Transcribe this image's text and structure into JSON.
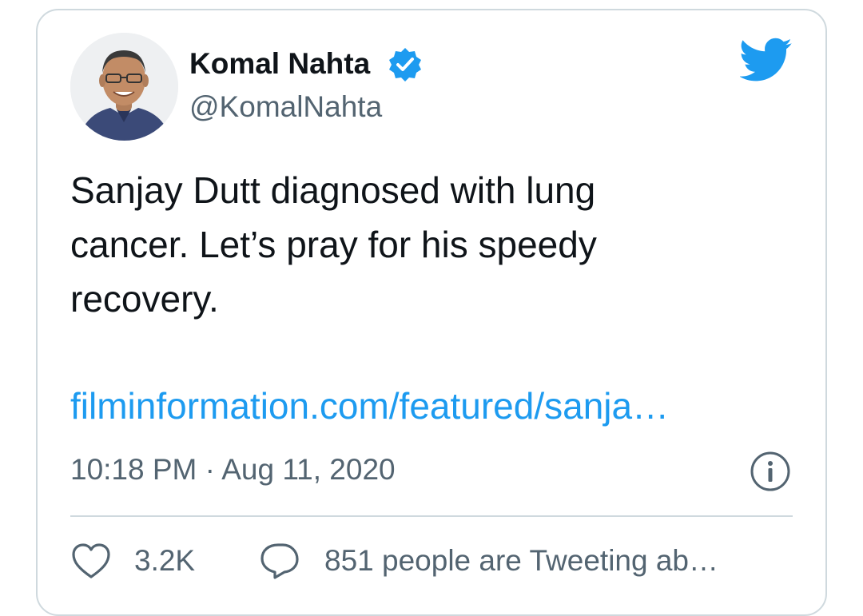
{
  "author": {
    "name": "Komal Nahta",
    "handle": "@KomalNahta",
    "verified": true
  },
  "tweet": {
    "text": "Sanjay Dutt diagnosed with lung\ncancer. Let’s pray for his speedy\nrecovery.",
    "link": "filminformation.com/featured/sanja…",
    "timestamp": "10:18 PM · Aug 11, 2020"
  },
  "actions": {
    "likes": "3.2K",
    "conversation": "851 people are Tweeting ab…"
  },
  "icons": {
    "brand": "twitter-bird-icon",
    "verified": "verified-badge-icon",
    "info": "info-icon",
    "like": "heart-icon",
    "reply": "speech-bubble-icon"
  },
  "colors": {
    "brand": "#1d9bf0",
    "text": "#0f1419",
    "secondary": "#536471",
    "border": "#cfd9de"
  }
}
